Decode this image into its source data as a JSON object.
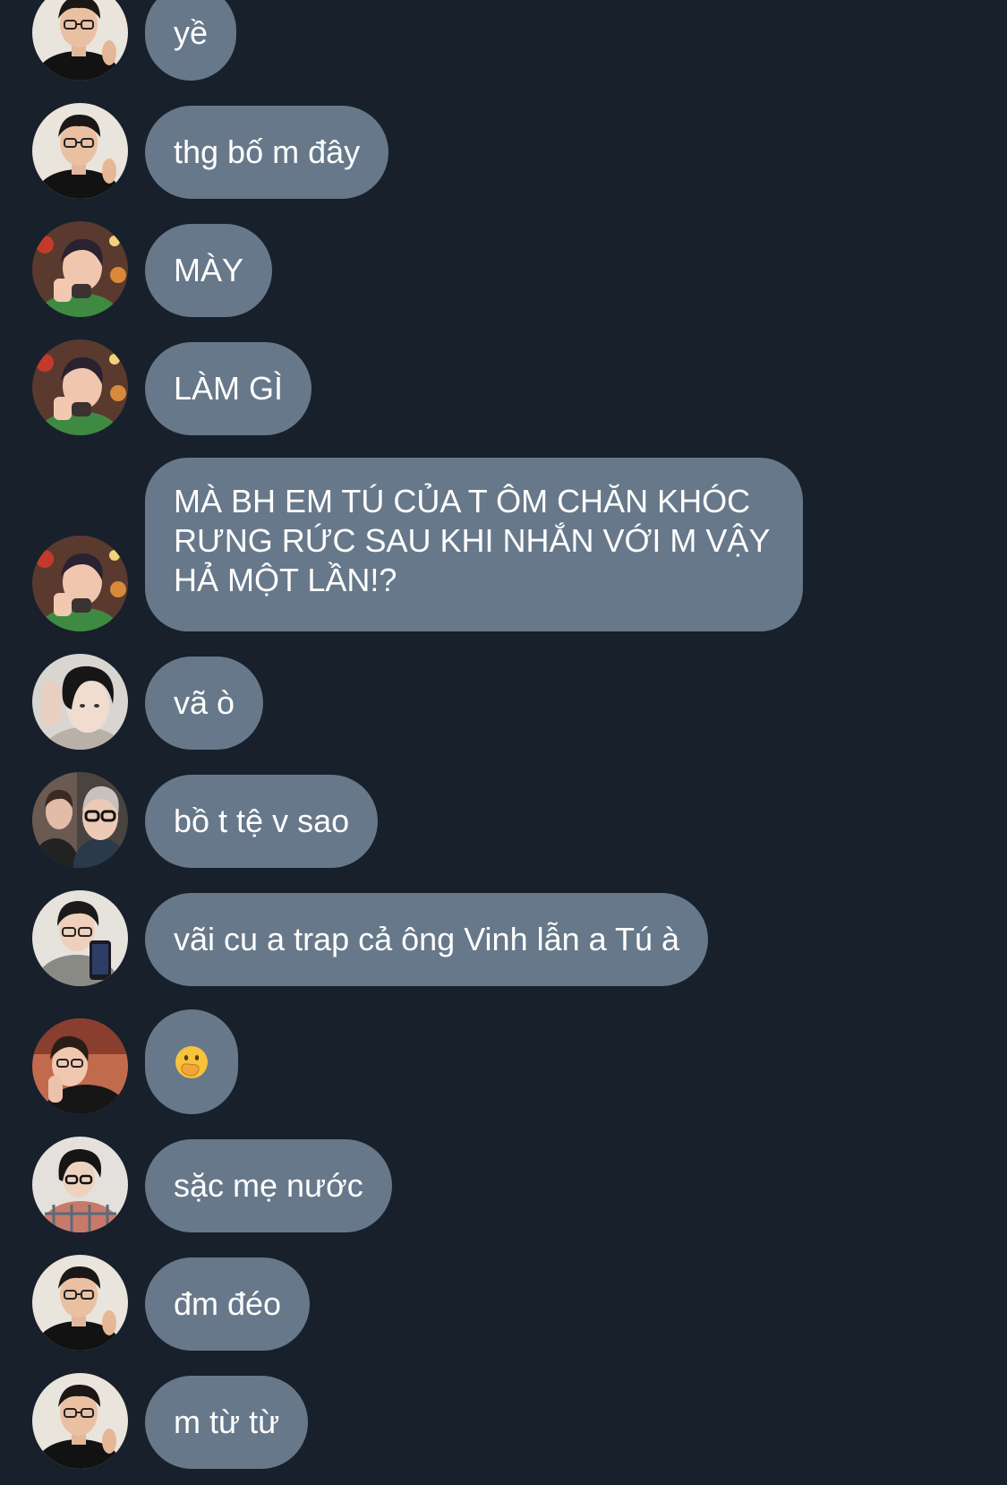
{
  "theme": {
    "background": "#17202b",
    "bubble_color": "#67788a",
    "text_color": "#ffffff"
  },
  "messages": [
    {
      "sender_avatar": "avatar-glasses-black-shirt",
      "text": "yề"
    },
    {
      "sender_avatar": "avatar-glasses-black-shirt",
      "text": "thg bố m đây"
    },
    {
      "sender_avatar": "avatar-green-sweater-christmas",
      "text": "MÀY"
    },
    {
      "sender_avatar": "avatar-green-sweater-christmas",
      "text": "LÀM GÌ"
    },
    {
      "sender_avatar": "avatar-green-sweater-christmas",
      "text": "MÀ BH EM TÚ CỦA T ÔM CHĂN KHÓC\nRƯNG RỨC SAU KHI NHẮN VỚI M VẬY\nHẢ MỘT LẦN!?"
    },
    {
      "sender_avatar": "avatar-dark-hair-selfie",
      "text": "vã ò"
    },
    {
      "sender_avatar": "avatar-two-people-glasses",
      "text": "bồ t tệ v sao"
    },
    {
      "sender_avatar": "avatar-mirror-selfie-phone",
      "text": "vãi cu a trap cả ông Vinh lẫn a Tú à"
    },
    {
      "sender_avatar": "avatar-lying-down-black-tee",
      "text": "",
      "emoji": "face-with-hand-over-mouth"
    },
    {
      "sender_avatar": "avatar-glasses-plaid-shirt",
      "text": "sặc mẹ nước"
    },
    {
      "sender_avatar": "avatar-glasses-black-shirt",
      "text": "đm đéo"
    },
    {
      "sender_avatar": "avatar-glasses-black-shirt",
      "text": "m từ từ"
    }
  ]
}
